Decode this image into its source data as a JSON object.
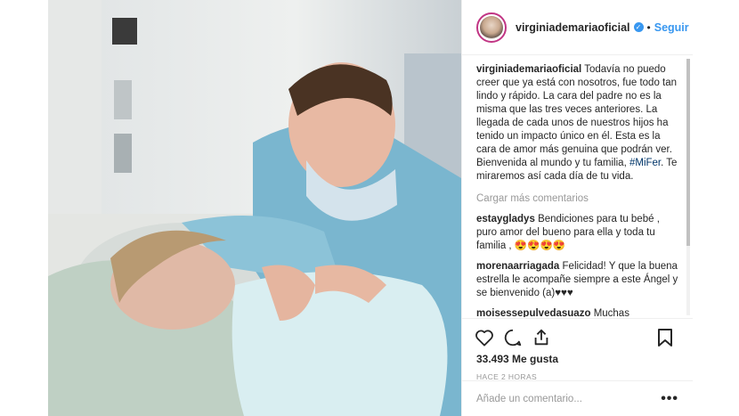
{
  "header": {
    "username": "virginiademariaoficial",
    "separator": "•",
    "follow_label": "Seguir"
  },
  "caption": {
    "username": "virginiademariaoficial",
    "text": "Todavía no puedo creer que ya está con nosotros, fue todo tan lindo y rápido. La cara del padre no es la misma que las tres veces anteriores. La llegada de cada unos de nuestros hijos ha tenido un impacto único en él. Esta es la cara de amor más genuina que podrán ver. Bienvenida al mundo y tu familia, ",
    "hashtag": "#MiFer",
    "text_after": ". Te miraremos así cada día de tu vida."
  },
  "load_more": "Cargar más comentarios",
  "comments": [
    {
      "user": "estaygladys",
      "text": "Bendiciones para tu bebé , puro amor del bueno para ella y toda tu familia , 😍😍😍😍"
    },
    {
      "user": "morenaarriagada",
      "text": "Felicidad! Y que la buena estrella le acompañe siempre a este Ángel y se bienvenido (a)♥♥♥"
    },
    {
      "user": "moisessepulvedasuazo",
      "text": "Muchas felicidades y que Dios los bendiga siempre Saludos un gran abrazo"
    }
  ],
  "likes": "33.493 Me gusta",
  "time_ago": "HACE 2 HORAS",
  "add_comment_placeholder": "Añade un comentario...",
  "more_options": "•••",
  "icons": {
    "like": "heart-icon",
    "comment": "comment-icon",
    "share": "share-icon",
    "save": "bookmark-icon",
    "verified": "verified-badge-icon"
  },
  "colors": {
    "link": "#3897f0",
    "hashtag": "#003569",
    "muted": "#999999",
    "text": "#262626"
  }
}
